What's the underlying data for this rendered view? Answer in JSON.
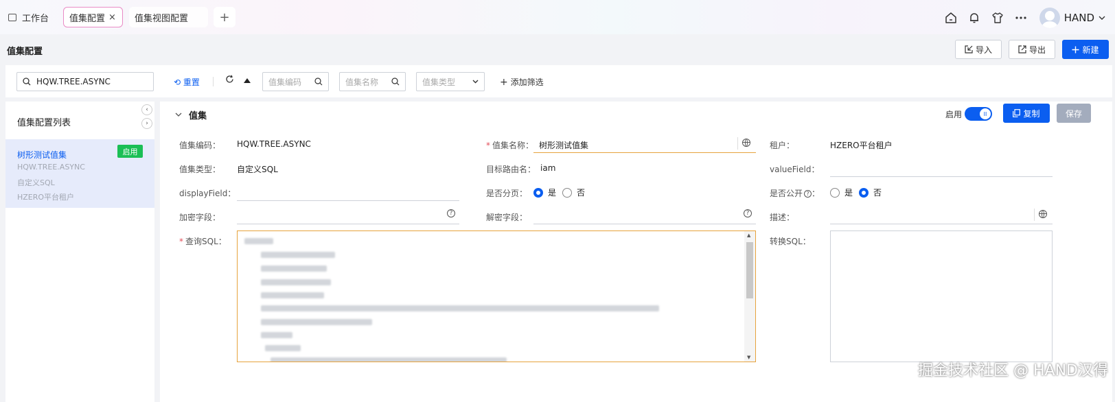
{
  "tabs": {
    "workbench": "工作台",
    "active": "值集配置",
    "active_close": "×",
    "view": "值集视图配置",
    "plus": "+"
  },
  "user": {
    "name": "HAND"
  },
  "header_icons": [
    "home-icon",
    "bell-icon",
    "shirt-icon",
    "more-icon"
  ],
  "page": {
    "title": "值集配置",
    "import": "导入",
    "export": "导出",
    "new": "新建"
  },
  "filter": {
    "search_value": "HQW.TREE.ASYNC",
    "reset": "重置",
    "code_placeholder": "值集编码",
    "name_placeholder": "值集名称",
    "type_placeholder": "值集类型",
    "add_filter": "添加筛选"
  },
  "sidebar": {
    "title": "值集配置列表",
    "item": {
      "name": "树形测试值集",
      "tag": "启用",
      "code": "HQW.TREE.ASYNC",
      "type": "自定义SQL",
      "tenant": "HZERO平台租户"
    }
  },
  "section": {
    "title": "值集",
    "enabled_label": "启用",
    "enabled": true,
    "copy": "复制",
    "save": "保存"
  },
  "form": {
    "code_label": "值集编码：",
    "code": "HQW.TREE.ASYNC",
    "name_label": "值集名称：",
    "name": "树形测试值集",
    "tenant_label": "租户：",
    "tenant": "HZERO平台租户",
    "type_label": "值集类型：",
    "type": "自定义SQL",
    "route_label": "目标路由名：",
    "route": "iam",
    "value_field_label": "valueField：",
    "value_field": "",
    "display_field_label": "displayField：",
    "display_field": "",
    "paging_label": "是否分页：",
    "paging": "是",
    "public_label": "是否公开",
    "public": "否",
    "yes": "是",
    "no": "否",
    "encrypt_label": "加密字段：",
    "decrypt_label": "解密字段：",
    "desc_label": "描述：",
    "sql_label": "查询SQL：",
    "trans_sql_label": "转换SQL："
  },
  "watermark": "掘金技术社区 @ HAND汉得"
}
